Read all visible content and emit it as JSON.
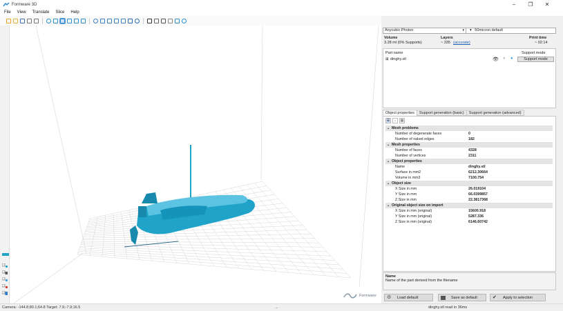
{
  "window": {
    "title": "Formware 3D",
    "minimize": "–",
    "maximize": "❐",
    "close": "✕"
  },
  "menu": [
    "File",
    "View",
    "Translate",
    "Slice",
    "Help"
  ],
  "toolbar": {
    "icons": [
      "new-file-icon",
      "open-folder-icon",
      "save-icon",
      "undo-icon",
      "redo-icon",
      "view-iso-icon",
      "view-front-icon",
      "view-top-icon",
      "view-side-icon",
      "view-back-icon",
      "view-bottom-icon",
      "move-icon",
      "rotate-icon",
      "scale-icon",
      "mirror-icon",
      "arrange-icon",
      "duplicate-icon",
      "cut-icon",
      "hollow-icon",
      "support-icon",
      "measure-icon",
      "layer-icon",
      "slice-icon",
      "export-icon"
    ]
  },
  "status": {
    "camera": "Camera: -144.8;80.1;64.8   Target: 7.9;-7.9;16.5",
    "middle": "...",
    "right": "dinghy.stl read in 36ms"
  },
  "printer": {
    "machine": "Anycubic Photon",
    "profile": "50micron default"
  },
  "summary": {
    "volume_label": "Volume",
    "volume_value": "3.28 ml (0% Supports)",
    "layers_label": "Layers",
    "layers_value": "~ 335",
    "layers_link": "(accurate)",
    "time_label": "Print time",
    "time_value": "~ 02:14"
  },
  "parts": {
    "col_name": "Part name",
    "col_mode": "Support mode",
    "rows": [
      {
        "name": "dinghy.stl",
        "mode": "Support mode"
      }
    ]
  },
  "tabs": [
    "Object properties",
    "Support generation (basic)",
    "Support generation (advanced)"
  ],
  "properties": [
    {
      "cat": true,
      "name": "Mesh problems"
    },
    {
      "name": "Number of degenerate faces",
      "value": "0"
    },
    {
      "name": "Number of naked edges",
      "value": "182"
    },
    {
      "cat": true,
      "name": "Mesh properties"
    },
    {
      "name": "Number of faces",
      "value": "4328"
    },
    {
      "name": "Number of vertices",
      "value": "2311"
    },
    {
      "cat": true,
      "name": "Object properties"
    },
    {
      "name": "Name",
      "value": "dinghy.stl"
    },
    {
      "name": "Surface in mm2",
      "value": "6212.30664"
    },
    {
      "name": "Volume in mm3",
      "value": "7100.754"
    },
    {
      "cat": true,
      "name": "Object size"
    },
    {
      "name": "X Size in mm",
      "value": "26.019104"
    },
    {
      "name": "Y Size in mm",
      "value": "66.0399857"
    },
    {
      "name": "Z Size in mm",
      "value": "22.3817368"
    },
    {
      "cat": true,
      "name": "Original object size on import"
    },
    {
      "name": "X Size in mm (original)",
      "value": "15600.918"
    },
    {
      "name": "Y Size in mm (original)",
      "value": "5287.336"
    },
    {
      "name": "Z Size in mm (original)",
      "value": "6146.60742"
    }
  ],
  "description": {
    "title": "Name",
    "text": "Name of the part derived from the filename"
  },
  "buttons": {
    "load": "Load default",
    "save": "Save as default",
    "apply": "Apply to selection"
  },
  "watermark": "Formware",
  "colors": {
    "model": "#1fa3c9",
    "accent": "#1a5fb4",
    "grid": "#d5d5d5"
  }
}
